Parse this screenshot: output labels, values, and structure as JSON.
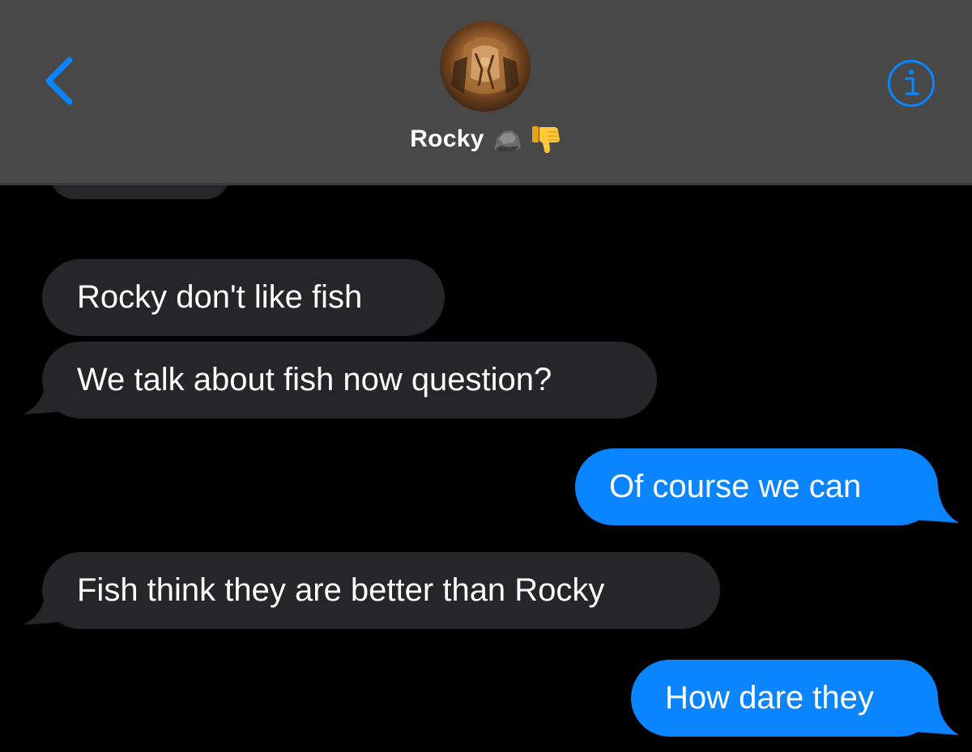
{
  "header": {
    "contact_name": "Rocky",
    "name_emoji_rock": "rock-icon",
    "name_emoji_thumbs": "thumbs-down-icon",
    "back_icon": "chevron-left-icon",
    "info_icon": "info-icon",
    "accent_color": "#0a84ff",
    "background_color": "#484848"
  },
  "messages": [
    {
      "direction": "incoming",
      "text": "Rocky don't like fish"
    },
    {
      "direction": "incoming",
      "text": "We talk about fish now question?"
    },
    {
      "direction": "outgoing",
      "text": "Of course we can"
    },
    {
      "direction": "incoming",
      "text": "Fish think they are better than Rocky"
    },
    {
      "direction": "outgoing",
      "text": "How dare they"
    }
  ],
  "colors": {
    "incoming_bubble": "#262628",
    "outgoing_bubble": "#0a84ff",
    "screen_background": "#000000"
  }
}
